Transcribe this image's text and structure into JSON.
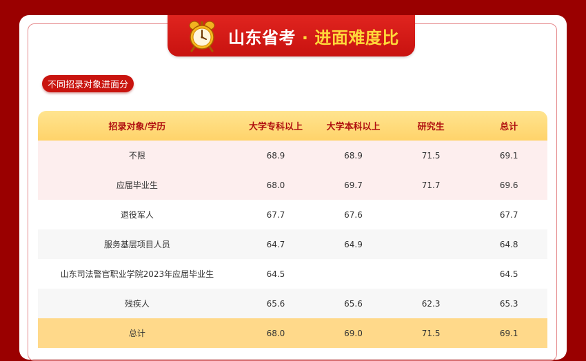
{
  "banner": {
    "title_main": "山东省考",
    "title_accent": "· 进面难度比"
  },
  "section_label": "不同招录对象进面分",
  "table": {
    "headers": [
      "招录对象/学历",
      "大学专科以上",
      "大学本科以上",
      "研究生",
      "总计"
    ],
    "rows": [
      {
        "name": "不限",
        "cells": [
          "68.9",
          "68.9",
          "71.5",
          "69.1"
        ]
      },
      {
        "name": "应届毕业生",
        "cells": [
          "68.0",
          "69.7",
          "71.7",
          "69.6"
        ]
      },
      {
        "name": "退役军人",
        "cells": [
          "67.7",
          "67.6",
          "",
          "67.7"
        ]
      },
      {
        "name": "服务基层项目人员",
        "cells": [
          "64.7",
          "64.9",
          "",
          "64.8"
        ]
      },
      {
        "name": "山东司法警官职业学院2023年应届毕业生",
        "cells": [
          "64.5",
          "",
          "",
          "64.5"
        ]
      },
      {
        "name": "残疾人",
        "cells": [
          "65.6",
          "65.6",
          "62.3",
          "65.3"
        ]
      },
      {
        "name": "总计",
        "cells": [
          "68.0",
          "69.0",
          "71.5",
          "69.1"
        ]
      }
    ]
  },
  "colors": {
    "background": "#9a0000",
    "banner_red": "#d81b17",
    "accent_yellow": "#ffd83a",
    "header_gold": "#ffd36a",
    "header_text": "#b01010"
  },
  "icons": {
    "banner_icon": "alarm-clock-icon"
  }
}
